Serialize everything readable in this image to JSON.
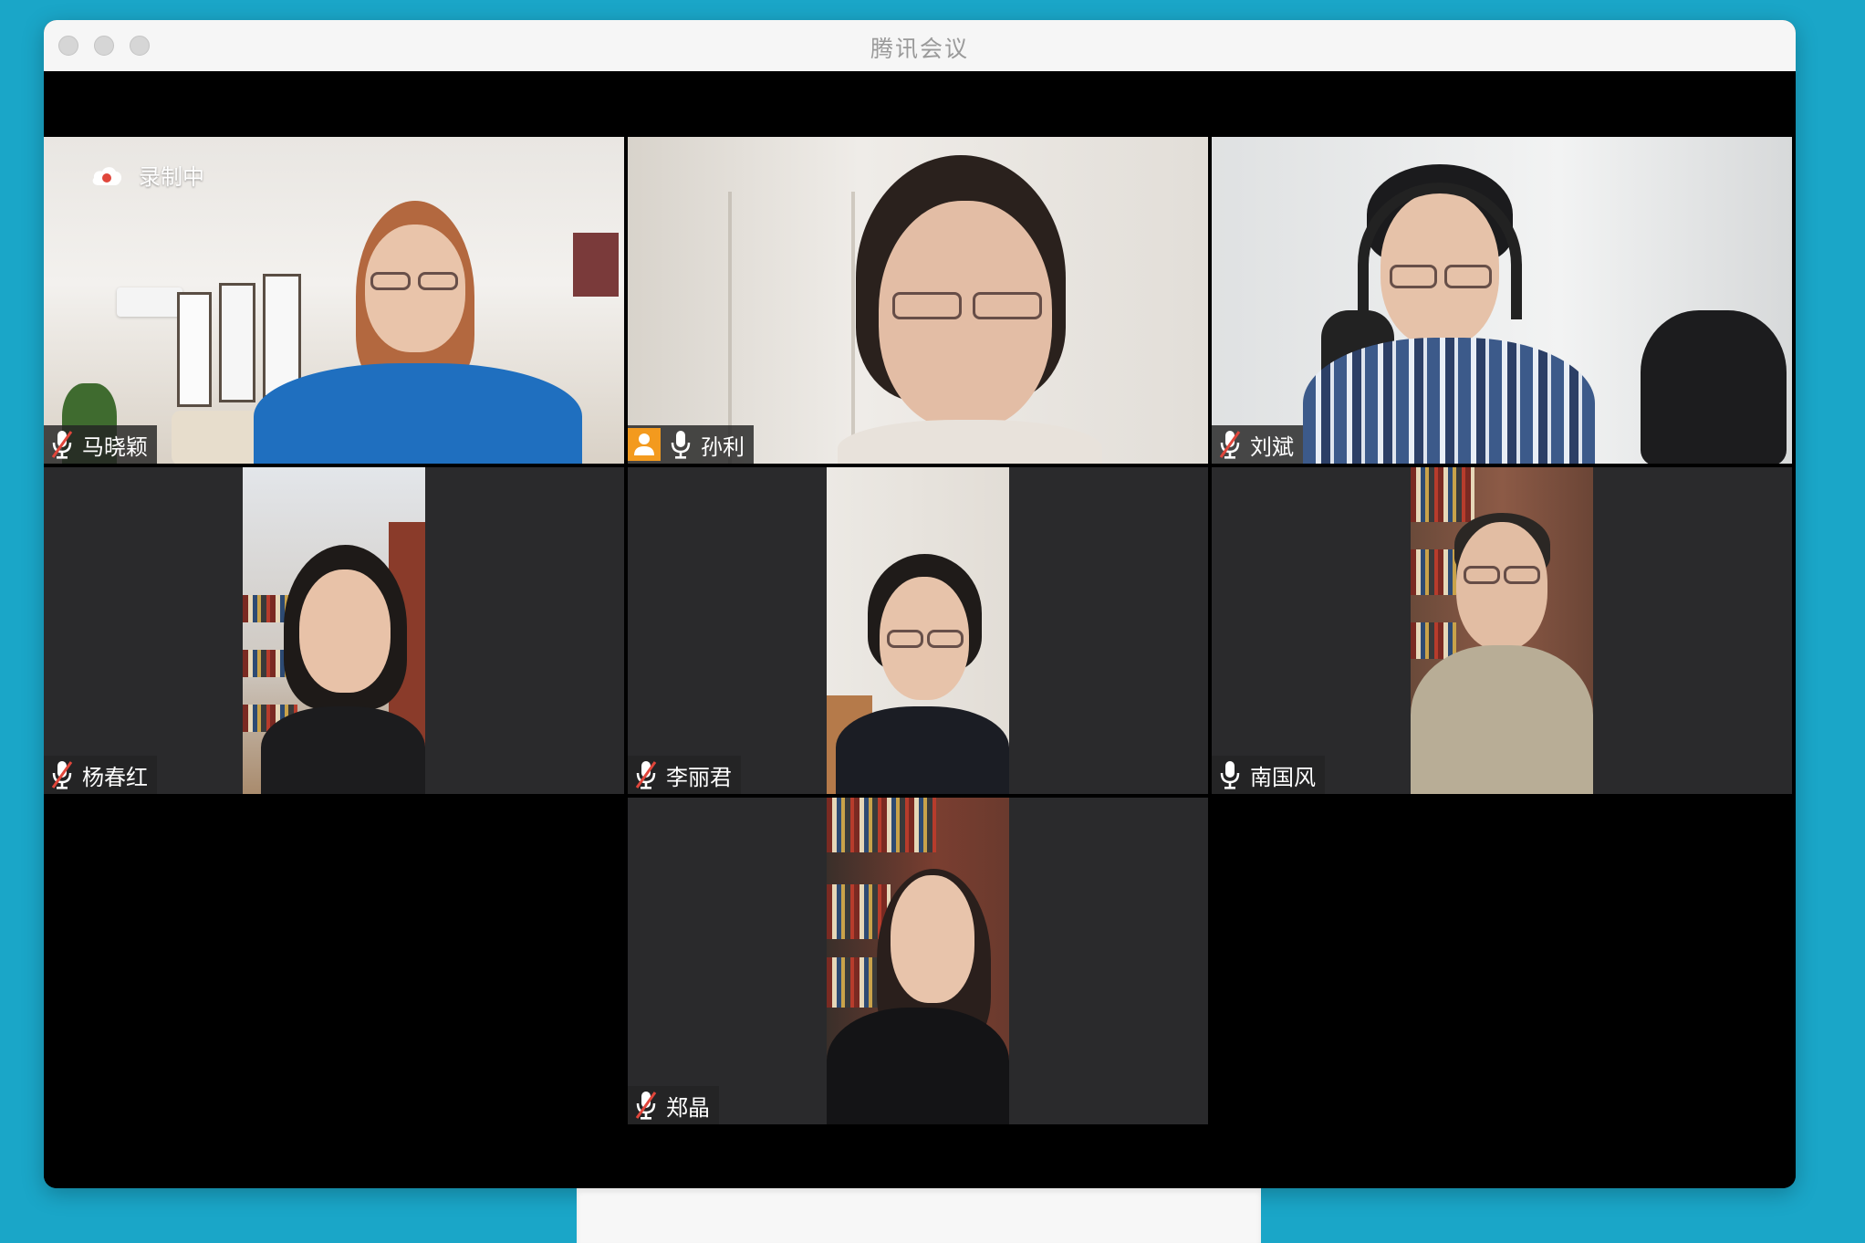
{
  "window": {
    "title": "腾讯会议"
  },
  "recording": {
    "label": "录制中",
    "icon": "cloud-record-icon"
  },
  "colors": {
    "desktop_background": "#1aa6c8",
    "host_badge": "#f39a1e",
    "mute_slash": "#e0463b"
  },
  "participants": [
    {
      "name": "马晓颖",
      "mic": "muted",
      "video": "landscape"
    },
    {
      "name": "孙利",
      "mic": "on",
      "host": true,
      "video": "landscape"
    },
    {
      "name": "刘斌",
      "mic": "muted",
      "video": "landscape"
    },
    {
      "name": "杨春红",
      "mic": "muted",
      "video": "portrait"
    },
    {
      "name": "李丽君",
      "mic": "muted",
      "video": "portrait"
    },
    {
      "name": "南国风",
      "mic": "on",
      "video": "portrait"
    },
    {
      "name": "郑晶",
      "mic": "muted",
      "video": "portrait"
    }
  ]
}
